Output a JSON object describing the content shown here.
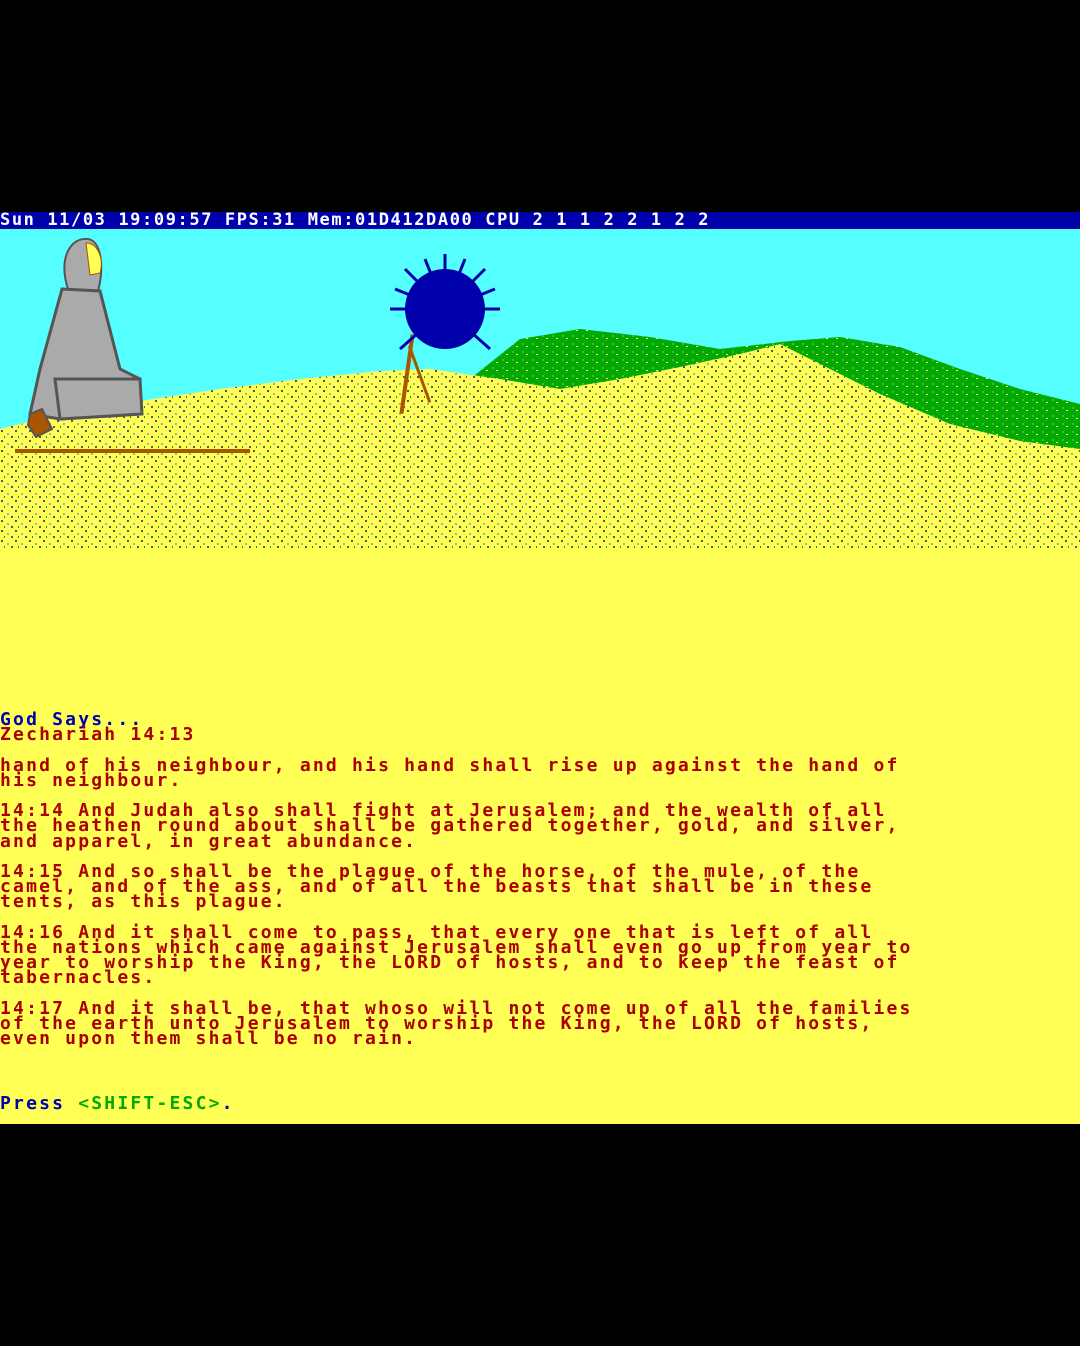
{
  "status_bar": {
    "text": "Sun 11/03 19:09:57 FPS:31 Mem:01D412DA00 CPU 2 1 1 2 2 1 2 2"
  },
  "colors": {
    "sky": "#55ffff",
    "sand": "#ffff55",
    "hills": "#00aa00",
    "status_bg": "#0000aa",
    "scripture_text": "#aa0000",
    "heading_text": "#0000aa",
    "key_text": "#00aa00"
  },
  "scene": {
    "figure_icon": "seated-robed-figure-icon",
    "bush_icon": "blue-thorn-bush-icon"
  },
  "heading": {
    "title": "God Says...",
    "reference": "Zechariah 14:13"
  },
  "passage": [
    [
      "hand of his neighbour, and his hand shall rise up against the hand of",
      "his neighbour."
    ],
    [
      "14:14 And Judah also shall fight at Jerusalem; and the wealth of all",
      "the heathen round about shall be gathered together, gold, and silver,",
      "and apparel, in great abundance."
    ],
    [
      "14:15 And so shall be the plague of the horse, of the mule, of the",
      "camel, and of the ass, and of all the beasts that shall be in these",
      "tents, as this plague."
    ],
    [
      "14:16 And it shall come to pass, that every one that is left of all",
      "the nations which came against Jerusalem shall even go up from year to",
      "year to worship the King, the LORD of hosts, and to keep the feast of",
      "tabernacles."
    ],
    [
      "14:17 And it shall be, that whoso will not come up of all the families",
      "of the earth unto Jerusalem to worship the King, the LORD of hosts,",
      "even upon them shall be no rain."
    ]
  ],
  "prompt": {
    "press_label": "Press ",
    "key_label": "<SHIFT-ESC>",
    "suffix": "."
  }
}
